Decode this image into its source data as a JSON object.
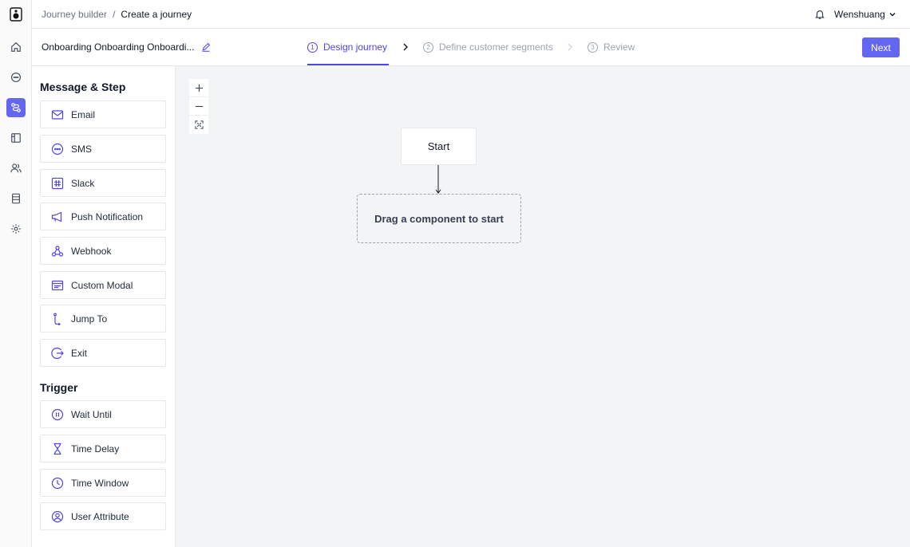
{
  "header": {
    "breadcrumb_root": "Journey builder",
    "breadcrumb_sep": "/",
    "breadcrumb_current": "Create a journey",
    "user_name": "Wenshuang"
  },
  "journey": {
    "name": "Onboarding Onboarding Onboardi..."
  },
  "steps": [
    {
      "num": "1",
      "label": "Design journey"
    },
    {
      "num": "2",
      "label": "Define customer segments"
    },
    {
      "num": "3",
      "label": "Review"
    }
  ],
  "next_label": "Next",
  "panel": {
    "message_title": "Message & Step",
    "message_items": [
      "Email",
      "SMS",
      "Slack",
      "Push Notification",
      "Webhook",
      "Custom Modal",
      "Jump To",
      "Exit"
    ],
    "trigger_title": "Trigger",
    "trigger_items": [
      "Wait Until",
      "Time Delay",
      "Time Window",
      "User Attribute"
    ]
  },
  "canvas": {
    "start_label": "Start",
    "dropzone_label": "Drag a component to start"
  },
  "colors": {
    "accent": "#6366f1",
    "accent_text": "#4f46e5"
  },
  "icons": {
    "rail": [
      "home-icon",
      "chat-icon",
      "journey-icon",
      "template-icon",
      "users-icon",
      "database-icon",
      "settings-icon"
    ]
  }
}
